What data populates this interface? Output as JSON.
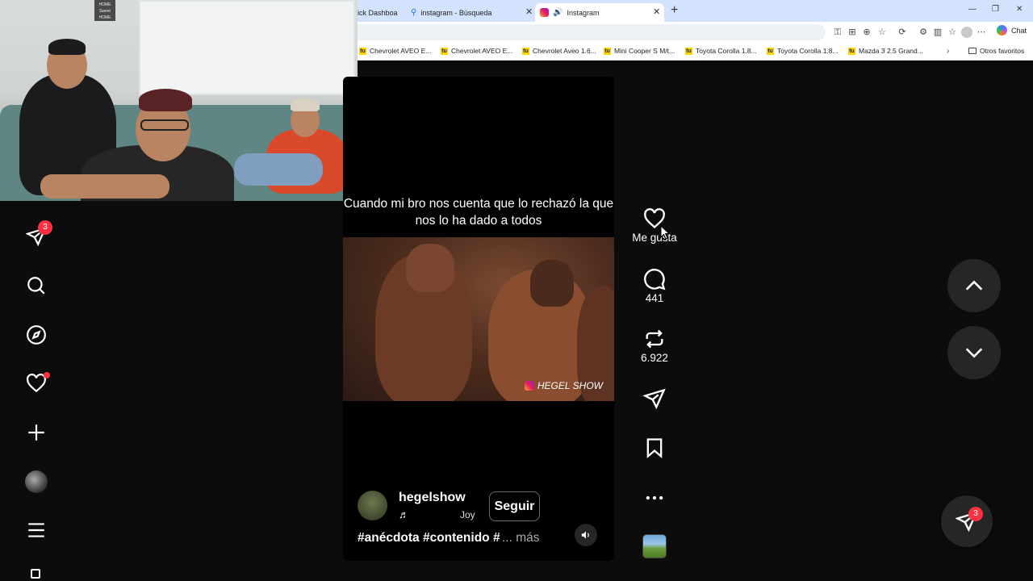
{
  "browser": {
    "tabs": [
      {
        "label": "ick Dashboa",
        "favicon": "dashboard-icon"
      },
      {
        "label": "instagram - Búsqueda",
        "favicon": "search-icon"
      },
      {
        "label": "Instagram",
        "favicon": "instagram-icon",
        "active": true
      }
    ],
    "chat_label": "Chat",
    "bookmarks": [
      "Chevrolet AVEO E...",
      "Chevrolet AVEO E...",
      "Chevrolet Aveo 1.6...",
      "Mini Cooper S M/t...",
      "Toyota Corolla 1.8...",
      "Toyota Corolla 1.8...",
      "Mazda 3 2.5 Grand..."
    ],
    "other_favorites": "Otros favoritos",
    "bookmark_icon_letter": "tu"
  },
  "webcam": {
    "sign_text": "HOME Sweet HOME"
  },
  "nav": {
    "notifications_badge": "3",
    "items": [
      "messages-icon",
      "search-icon",
      "explore-icon",
      "likes-icon",
      "create-icon",
      "profile-avatar",
      "menu-icon"
    ]
  },
  "reel": {
    "caption": "Cuando mi bro nos cuenta que lo rechazó la que nos lo ha dado a todos",
    "watermark": "HEGEL SHOW",
    "username": "hegelshow",
    "music_icon": "♬",
    "audio_name": "Joy",
    "follow_label": "Seguir",
    "hashtags": "#anécdota #contenido #",
    "more_label": "... más"
  },
  "actions": {
    "like_label": "Me gusta",
    "comments_count": "441",
    "reposts_count": "6.922"
  },
  "fab": {
    "badge": "3"
  },
  "colors": {
    "accent_red": "#ff3040",
    "background": "#0c0c0c",
    "tab_strip": "#d3e3fd"
  }
}
